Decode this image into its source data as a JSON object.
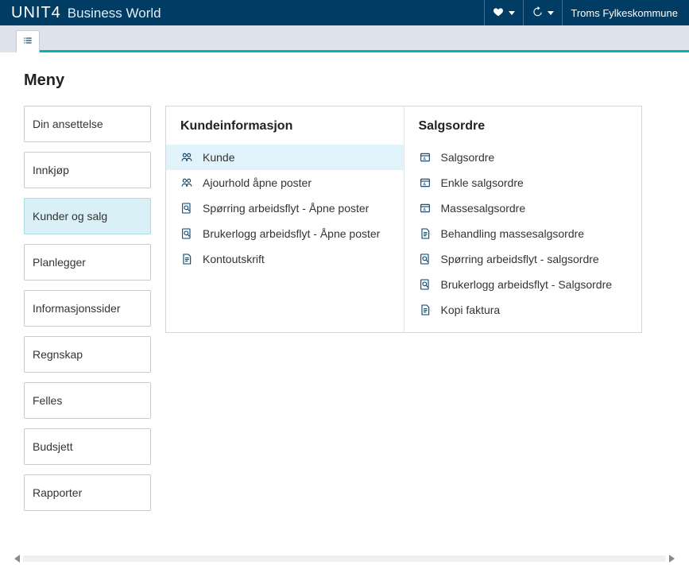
{
  "brand": {
    "logo": "UNIT4",
    "product": "Business World"
  },
  "topbar": {
    "org": "Troms Fylkeskommune"
  },
  "menu": {
    "title": "Meny",
    "items": [
      {
        "label": "Din ansettelse",
        "selected": false
      },
      {
        "label": "Innkjøp",
        "selected": false
      },
      {
        "label": "Kunder og salg",
        "selected": true
      },
      {
        "label": "Planlegger",
        "selected": false
      },
      {
        "label": "Informasjonssider",
        "selected": false
      },
      {
        "label": "Regnskap",
        "selected": false
      },
      {
        "label": "Felles",
        "selected": false
      },
      {
        "label": "Budsjett",
        "selected": false
      },
      {
        "label": "Rapporter",
        "selected": false
      }
    ]
  },
  "content": {
    "columns": [
      {
        "title": "Kundeinformasjon",
        "items": [
          {
            "icon": "people",
            "label": "Kunde",
            "selected": true
          },
          {
            "icon": "people",
            "label": "Ajourhold åpne poster"
          },
          {
            "icon": "search-doc",
            "label": "Spørring arbeidsflyt - Åpne poster"
          },
          {
            "icon": "search-doc",
            "label": "Brukerlogg arbeidsflyt - Åpne poster"
          },
          {
            "icon": "doc",
            "label": "Kontoutskrift"
          }
        ]
      },
      {
        "title": "Salgsordre",
        "items": [
          {
            "icon": "window",
            "label": "Salgsordre"
          },
          {
            "icon": "window",
            "label": "Enkle salgsordre"
          },
          {
            "icon": "window",
            "label": "Massesalgsordre"
          },
          {
            "icon": "doc",
            "label": "Behandling massesalgsordre"
          },
          {
            "icon": "search-doc",
            "label": "Spørring arbeidsflyt - salgsordre"
          },
          {
            "icon": "search-doc",
            "label": "Brukerlogg arbeidsflyt - Salgsordre"
          },
          {
            "icon": "doc",
            "label": "Kopi faktura"
          }
        ]
      }
    ]
  }
}
